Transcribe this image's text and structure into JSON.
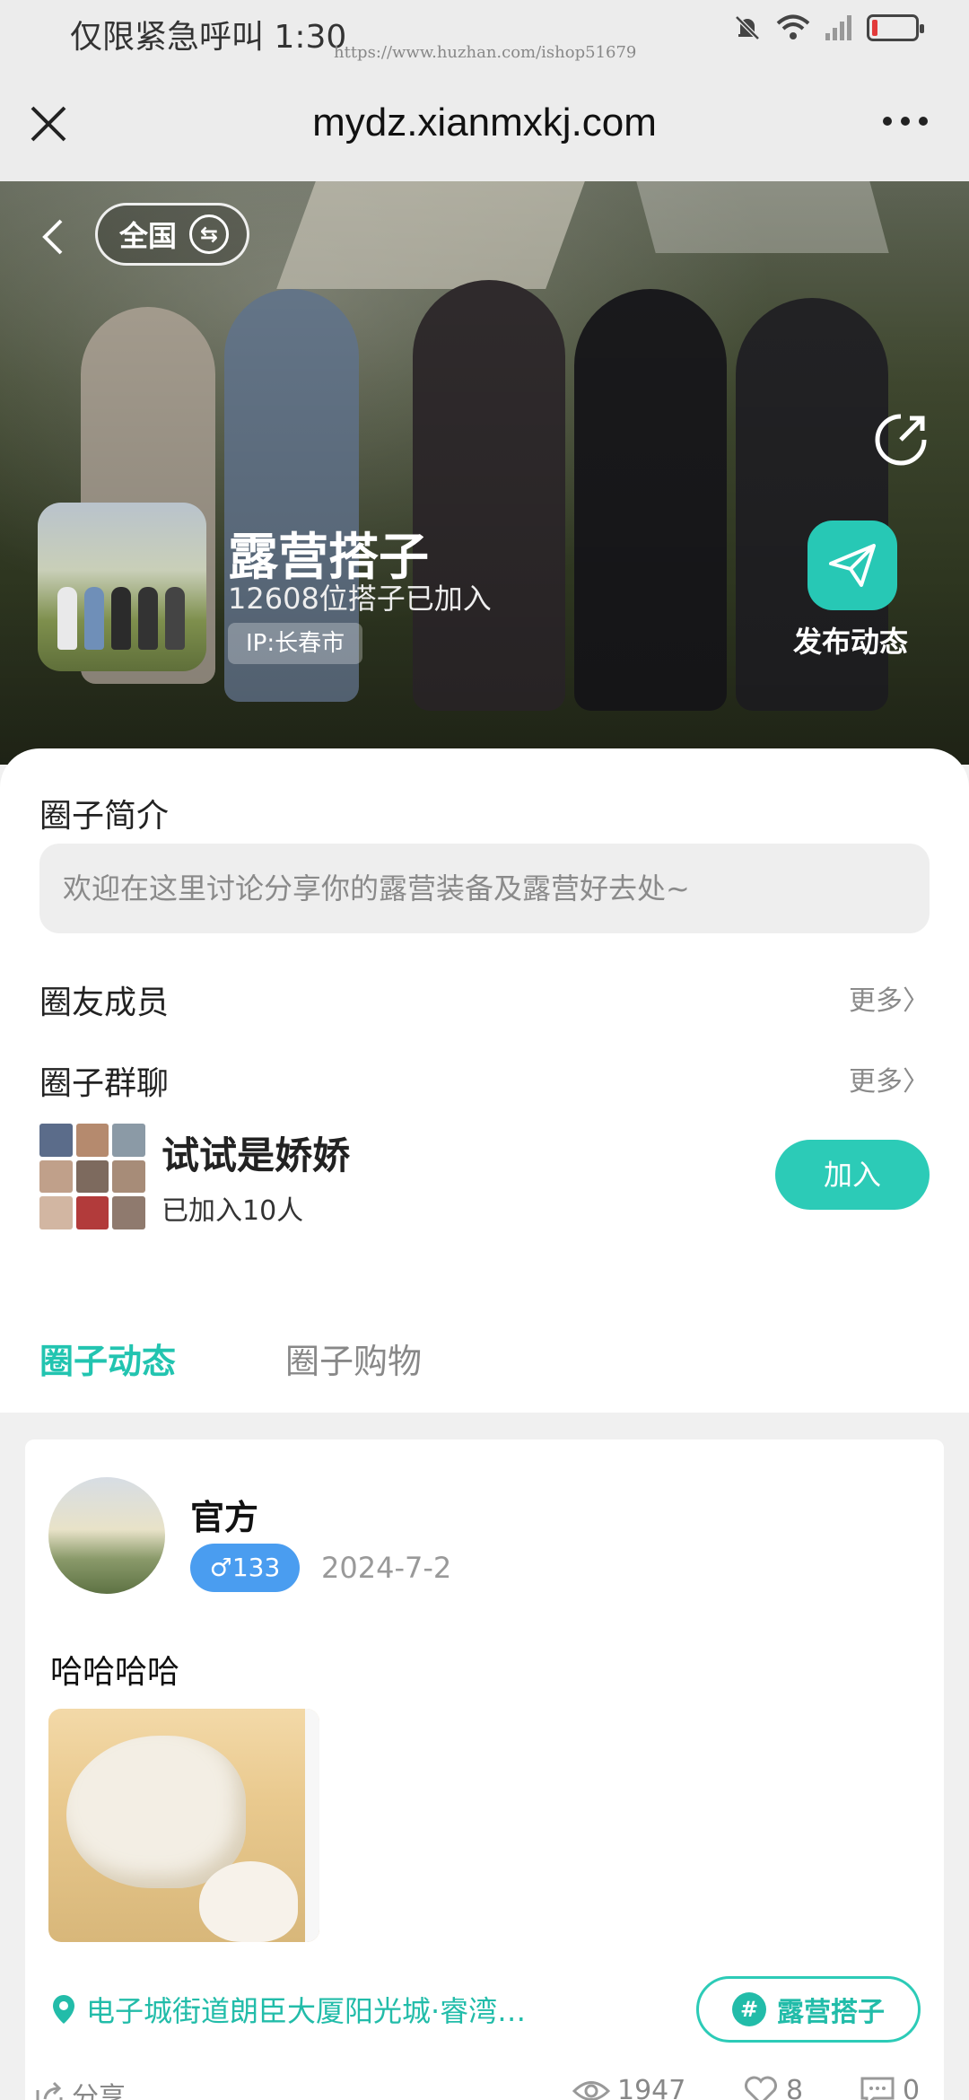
{
  "status_bar": {
    "carrier_text": "仅限紧急呼叫",
    "time": "1:30",
    "watermark": "https://www.huzhan.com/ishop51679",
    "icons": [
      "bell-muted-icon",
      "wifi-icon",
      "signal-icon",
      "battery-low-icon"
    ]
  },
  "browser": {
    "url": "mydz.xianmxkj.com",
    "close_icon": "close-icon",
    "more_icon": "more-icon"
  },
  "hero": {
    "region_label": "全国",
    "group_name": "露营搭子",
    "member_count_text": "12608位搭子已加入",
    "ip_text": "IP:长春市",
    "publish_label": "发布动态"
  },
  "intro": {
    "title": "圈子简介",
    "text": "欢迎在这里讨论分享你的露营装备及露营好去处~"
  },
  "members": {
    "title": "圈友成员",
    "more": "更多〉"
  },
  "group_chat": {
    "title": "圈子群聊",
    "more": "更多〉",
    "chat_name": "试试是娇娇",
    "chat_count": "已加入10人",
    "join_label": "加入"
  },
  "tabs": [
    {
      "label": "圈子动态",
      "active": true
    },
    {
      "label": "圈子购物",
      "active": false
    }
  ],
  "post": {
    "author": "官方",
    "gender_badge": "♂133",
    "date": "2024-7-2",
    "text": "哈哈哈哈",
    "location": "电子城街道朗臣大厦阳光城·睿湾…",
    "topic": "露营搭子",
    "share_label": "分享",
    "views": "1947",
    "likes": "8",
    "comments": "0"
  },
  "colors": {
    "accent": "#2ccbb7",
    "badge_blue": "#4a9df0"
  }
}
